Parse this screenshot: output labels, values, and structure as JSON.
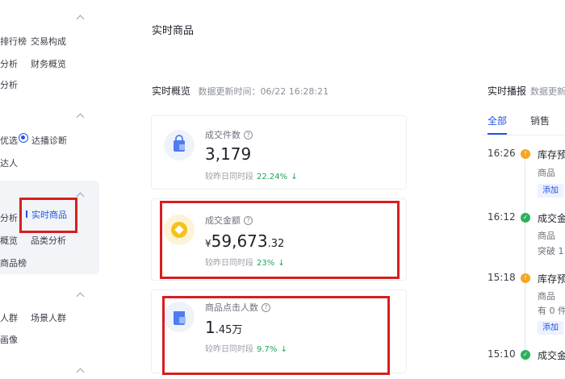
{
  "sidebar": {
    "items": [
      {
        "label": "排行榜"
      },
      {
        "label": "交易构成"
      },
      {
        "label": "分析"
      },
      {
        "label": "财务概览"
      },
      {
        "label": "分析"
      },
      {
        "label": "优选"
      },
      {
        "label": "达播诊断"
      },
      {
        "label": "达人"
      },
      {
        "label": "分析"
      },
      {
        "label": "实时商品"
      },
      {
        "label": "概览"
      },
      {
        "label": "品类分析"
      },
      {
        "label": "商品榜"
      },
      {
        "label": "人群"
      },
      {
        "label": "场景人群"
      },
      {
        "label": "画像"
      }
    ]
  },
  "main": {
    "title": "实时商品",
    "overview_title": "实时概览",
    "update_time": "数据更新时间：06/22 16:28:21"
  },
  "cards": [
    {
      "label": "成交件数",
      "value": "3,179",
      "cmp_label": "较昨日同时段",
      "pct": "22.24%"
    },
    {
      "label": "成交金额",
      "currency": "¥",
      "value_int": "59,673",
      "value_dec": ".32",
      "cmp_label": "较昨日同时段",
      "pct": "23%"
    },
    {
      "label": "商品点击人数",
      "value_num": "1",
      "value_dec": ".45",
      "value_unit": "万",
      "cmp_label": "较昨日同时段",
      "pct": "9.7%"
    }
  ],
  "feed": {
    "title": "实时播报",
    "subtitle": "数据更新",
    "tabs": [
      {
        "label": "全部"
      },
      {
        "label": "销售"
      }
    ],
    "events": [
      {
        "time": "16:26",
        "title": "库存预",
        "line1": "商品",
        "line2": "",
        "button": "添加"
      },
      {
        "time": "16:12",
        "title": "成交金",
        "line1": "商品",
        "line2": "突破 1",
        "button": ""
      },
      {
        "time": "15:18",
        "title": "库存预",
        "line1": "商品",
        "line2": "有 0 件",
        "button": "添加"
      },
      {
        "time": "15:10",
        "title": "成交金",
        "line1": "",
        "line2": "",
        "button": ""
      }
    ]
  },
  "icons": {
    "qmark": "?",
    "down_arrow": "↓",
    "check": "✓",
    "warn": "!"
  },
  "colors": {
    "accent": "#1f55e6",
    "highlight_box": "#d81e1e",
    "positive": "#23a35a"
  }
}
